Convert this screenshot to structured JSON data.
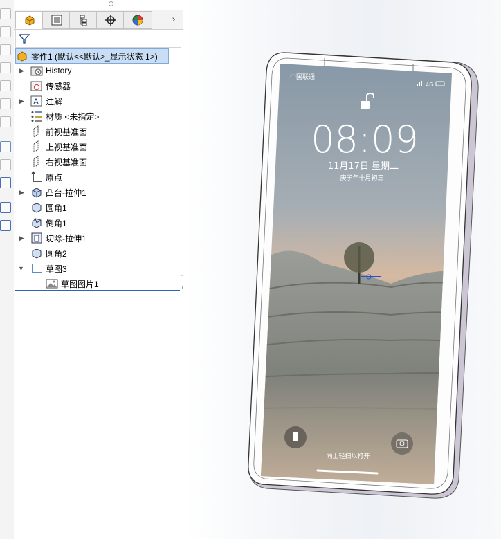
{
  "feature_tree": {
    "root": "零件1  (默认<<默认>_显示状态 1>)",
    "items": [
      {
        "label": "History"
      },
      {
        "label": "传感器"
      },
      {
        "label": "注解"
      },
      {
        "label": "材质 <未指定>"
      },
      {
        "label": "前视基准面"
      },
      {
        "label": "上视基准面"
      },
      {
        "label": "右视基准面"
      },
      {
        "label": "原点"
      },
      {
        "label": "凸台-拉伸1"
      },
      {
        "label": "圆角1"
      },
      {
        "label": "倒角1"
      },
      {
        "label": "切除-拉伸1"
      },
      {
        "label": "圆角2"
      },
      {
        "label": "草图3"
      },
      {
        "label": "草图图片1"
      }
    ]
  },
  "tabs": [
    {
      "icon": "feature-manager-icon"
    },
    {
      "icon": "property-manager-icon"
    },
    {
      "icon": "configuration-manager-icon"
    },
    {
      "icon": "dimxpert-icon"
    },
    {
      "icon": "display-manager-icon"
    }
  ],
  "lock_screen": {
    "carrier": "中国联通",
    "signal": "4G",
    "time": "08:09",
    "date": "11月17日 星期二",
    "lunar": "庚子年十月初三",
    "hint": "向上轻扫以打开"
  }
}
